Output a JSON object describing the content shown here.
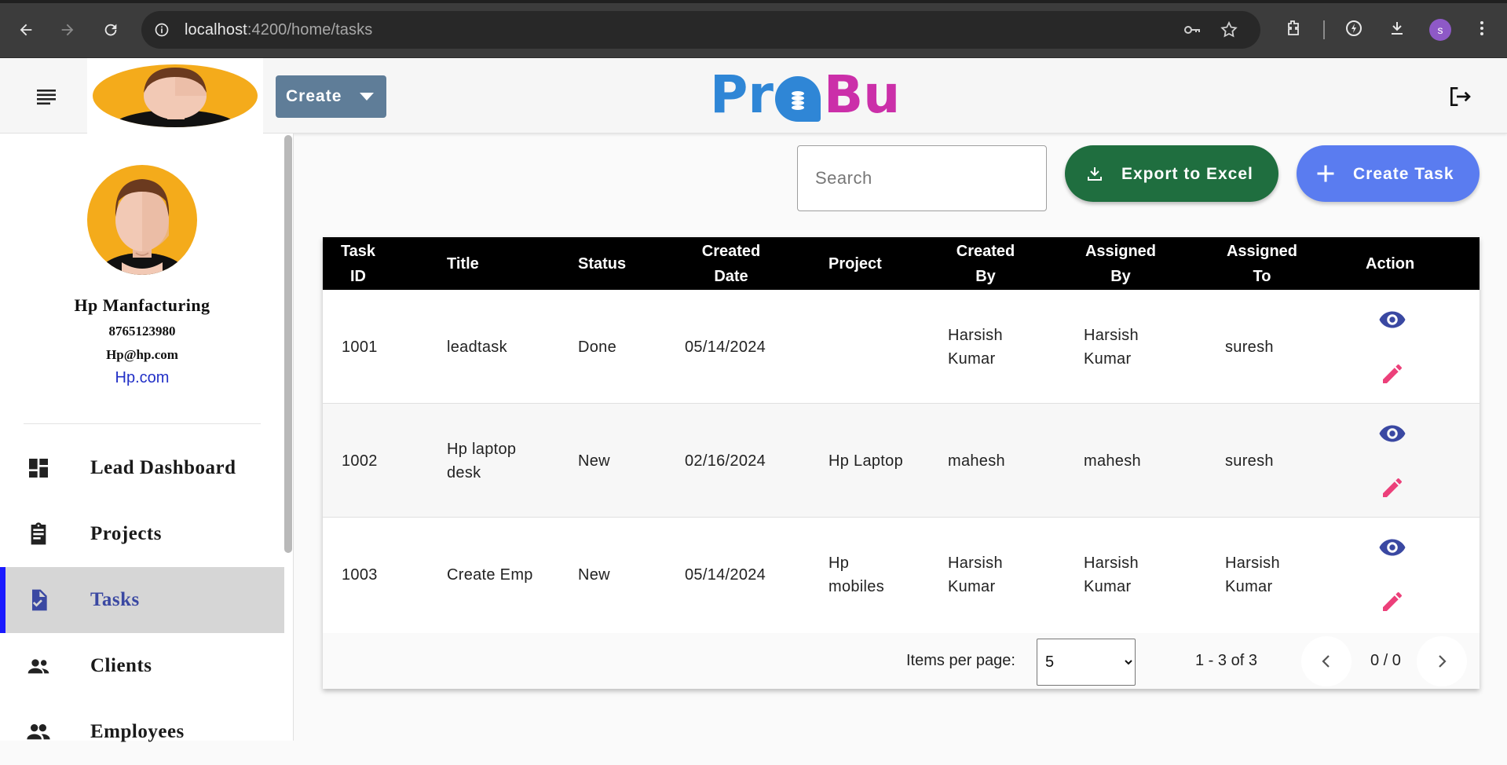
{
  "browser": {
    "url_host": "localhost",
    "url_path": ":4200/home/tasks",
    "profile_initial": "s"
  },
  "header": {
    "create_label": "Create",
    "brand_left": "Pr",
    "brand_right": "Bu"
  },
  "sidebar": {
    "company_name": "Hp Manfacturing",
    "phone": "8765123980",
    "email": "Hp@hp.com",
    "website": "Hp.com",
    "items": [
      {
        "label": "Lead Dashboard",
        "icon": "dashboard-icon"
      },
      {
        "label": "Projects",
        "icon": "clipboard-icon"
      },
      {
        "label": "Tasks",
        "icon": "task-icon",
        "active": true
      },
      {
        "label": "Clients",
        "icon": "clients-icon"
      },
      {
        "label": "Employees",
        "icon": "employees-icon"
      }
    ]
  },
  "toolbar": {
    "search_placeholder": "Search",
    "export_label": "Export to Excel",
    "create_task_label": "Create Task"
  },
  "table": {
    "headers": {
      "task_id_1": "Task",
      "task_id_2": "ID",
      "title": "Title",
      "status": "Status",
      "created_date_1": "Created",
      "created_date_2": "Date",
      "project": "Project",
      "created_by_1": "Created",
      "created_by_2": "By",
      "assigned_by_1": "Assigned",
      "assigned_by_2": "By",
      "assigned_to_1": "Assigned",
      "assigned_to_2": "To",
      "action": "Action"
    },
    "rows": [
      {
        "id": "1001",
        "title": "leadtask",
        "status": "Done",
        "created_date": "05/14/2024",
        "project": "",
        "created_by": "Harsish Kumar",
        "assigned_by": "Harsish Kumar",
        "assigned_to": "suresh"
      },
      {
        "id": "1002",
        "title": "Hp laptop desk",
        "status": "New",
        "created_date": "02/16/2024",
        "project": "Hp Laptop",
        "created_by": "mahesh",
        "assigned_by": "mahesh",
        "assigned_to": "suresh"
      },
      {
        "id": "1003",
        "title": "Create Emp",
        "status": "New",
        "created_date": "05/14/2024",
        "project": "Hp mobiles",
        "created_by": "Harsish Kumar",
        "assigned_by": "Harsish Kumar",
        "assigned_to": "Harsish Kumar"
      }
    ]
  },
  "paginator": {
    "items_per_page_label": "Items per page:",
    "items_per_page_value": "5",
    "range_label": "1 - 3 of 3",
    "page_label": "0 / 0"
  },
  "colors": {
    "export": "#1f6e3f",
    "create_task": "#5a7cf0",
    "view_icon": "#3a48a2",
    "edit_icon": "#ec407a"
  }
}
